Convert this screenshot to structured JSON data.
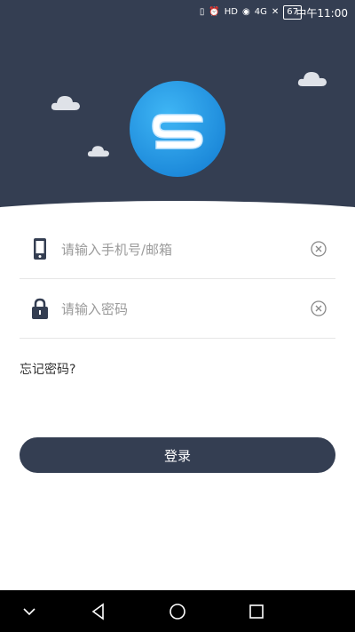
{
  "status_bar": {
    "network": "4G",
    "battery": "67",
    "time": "中午11:00"
  },
  "logo": {
    "letter": "S"
  },
  "login_form": {
    "account_placeholder": "请输入手机号/邮箱",
    "password_placeholder": "请输入密码",
    "forgot_password": "忘记密码?",
    "login_button": "登录"
  },
  "colors": {
    "header_bg": "#343e52",
    "button_bg": "#343e52",
    "logo_blue": "#2a9de8"
  },
  "nav_bar": {
    "items": [
      "chevron-down-icon",
      "back-icon",
      "home-icon",
      "recents-icon"
    ]
  }
}
